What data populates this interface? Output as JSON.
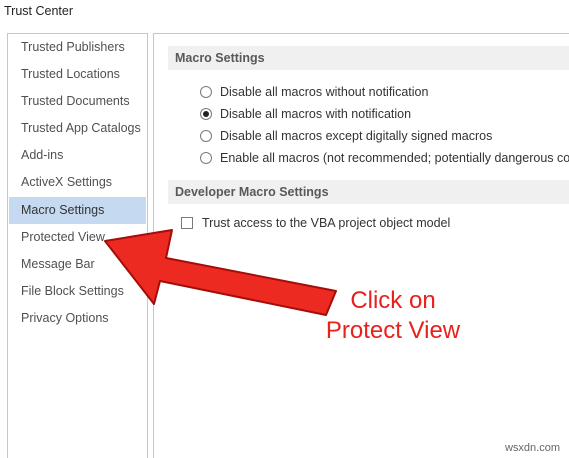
{
  "window": {
    "title": "Trust Center"
  },
  "sidebar": {
    "items": [
      {
        "label": "Trusted Publishers",
        "active": false
      },
      {
        "label": "Trusted Locations",
        "active": false
      },
      {
        "label": "Trusted Documents",
        "active": false
      },
      {
        "label": "Trusted App Catalogs",
        "active": false
      },
      {
        "label": "Add-ins",
        "active": false
      },
      {
        "label": "ActiveX Settings",
        "active": false
      },
      {
        "label": "Macro Settings",
        "active": true
      },
      {
        "label": "Protected View",
        "active": false
      },
      {
        "label": "Message Bar",
        "active": false
      },
      {
        "label": "File Block Settings",
        "active": false
      },
      {
        "label": "Privacy Options",
        "active": false
      }
    ]
  },
  "macro_settings": {
    "header": "Macro Settings",
    "options": [
      {
        "label": "Disable all macros without notification",
        "checked": false
      },
      {
        "label": "Disable all macros with notification",
        "checked": true
      },
      {
        "label": "Disable all macros except digitally signed macros",
        "checked": false
      },
      {
        "label": "Enable all macros (not recommended; potentially dangerous code",
        "checked": false
      }
    ]
  },
  "developer_settings": {
    "header": "Developer Macro Settings",
    "vba_access_label": "Trust access to the VBA project object model",
    "vba_access_checked": false
  },
  "annotation": {
    "line1": "Click on",
    "line2": "Protect View",
    "color": "#e8211b"
  },
  "watermark": "wsxdn.com",
  "colors": {
    "selected_bg": "#c5d9f1",
    "section_bg": "#f0f0f0",
    "border": "#c6c6c6"
  }
}
